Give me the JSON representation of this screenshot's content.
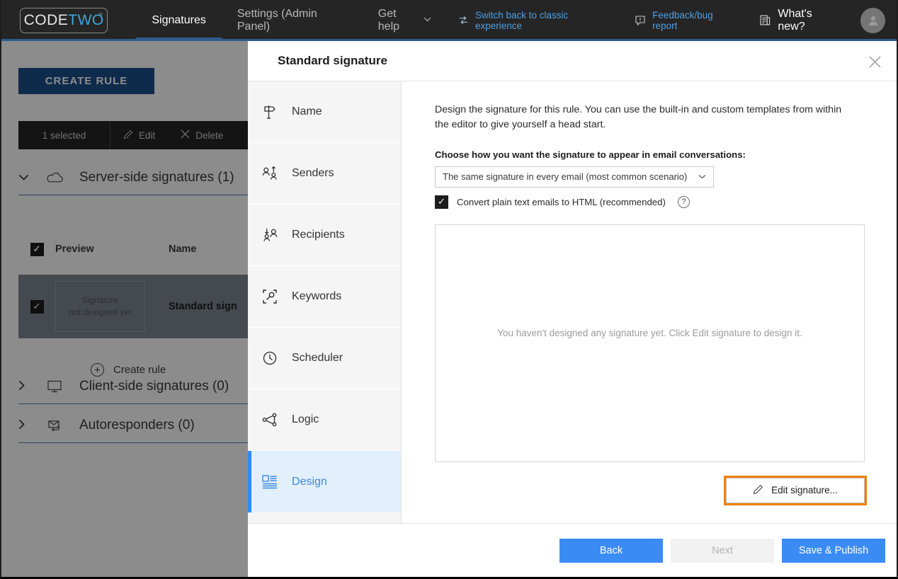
{
  "topbar": {
    "logo": {
      "part1": "CODE",
      "part2": "TWO",
      "tm": "®"
    },
    "tabs": [
      {
        "label": "Signatures",
        "active": true,
        "caret": ""
      },
      {
        "label": "Settings (Admin Panel)",
        "active": false,
        "caret": ""
      },
      {
        "label": "Get help",
        "active": false,
        "caret": "⌄"
      }
    ],
    "right": [
      {
        "label": "Switch back to classic experience",
        "icon": "switch-icon",
        "style": "link"
      },
      {
        "label": "Feedback/bug report",
        "icon": "feedback-icon",
        "style": "link"
      },
      {
        "label": "What's new?",
        "icon": "news-icon",
        "style": "white"
      }
    ],
    "avatar": "user-avatar"
  },
  "background": {
    "create_rule_button": "CREATE RULE",
    "toolbar": {
      "selected_count": "1 selected",
      "edit": "Edit",
      "delete": "Delete"
    },
    "groups": [
      {
        "label": "Server-side signatures (1)",
        "expanded": true,
        "icon": "cloud-icon",
        "chevron": "⌄"
      },
      {
        "label": "Client-side signatures (0)",
        "expanded": false,
        "icon": "monitor-icon",
        "chevron": "›"
      },
      {
        "label": "Autoresponders (0)",
        "expanded": false,
        "icon": "autoreply-icon",
        "chevron": "›"
      }
    ],
    "table_headers": {
      "preview": "Preview",
      "name": "Name"
    },
    "row": {
      "thumb_line1": "Signature",
      "thumb_line2": "not designed yet",
      "name": "Standard sign"
    },
    "create_rule_link": "Create rule"
  },
  "modal": {
    "title": "Standard signature",
    "close_icon": "close-icon",
    "rail": [
      {
        "label": "Name",
        "icon": "signpost-icon",
        "active": false
      },
      {
        "label": "Senders",
        "icon": "senders-icon",
        "active": false
      },
      {
        "label": "Recipients",
        "icon": "recipients-icon",
        "active": false
      },
      {
        "label": "Keywords",
        "icon": "keywords-icon",
        "active": false
      },
      {
        "label": "Scheduler",
        "icon": "clock-icon",
        "active": false
      },
      {
        "label": "Logic",
        "icon": "logic-icon",
        "active": false
      },
      {
        "label": "Design",
        "icon": "design-icon",
        "active": true
      }
    ],
    "content": {
      "intro": "Design the signature for this rule. You can use the built-in and custom templates from within the editor to give yourself a head start.",
      "choose_label": "Choose how you want the signature to appear in email conversations:",
      "select_value": "The same signature in every email (most common scenario)",
      "checkbox_label": "Convert plain text emails to HTML (recommended)",
      "checkbox_checked": true,
      "help_icon": "?",
      "preview_placeholder": "You haven't designed any signature yet. Click Edit signature to design it.",
      "edit_button": "Edit signature...",
      "edit_button_icon": "pencil-icon"
    },
    "footer": {
      "back": "Back",
      "next": "Next",
      "save": "Save & Publish"
    }
  },
  "colors": {
    "accent_blue": "#3b8bf5",
    "brand_dark": "#252526",
    "highlight_orange": "#f08000",
    "header_blue": "#2f5c8f"
  }
}
